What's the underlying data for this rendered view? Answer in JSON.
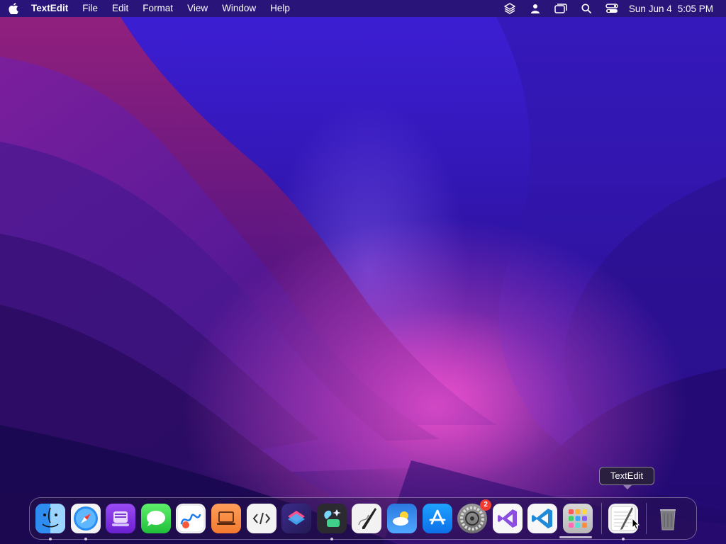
{
  "menubar": {
    "apple_icon": "apple-logo-icon",
    "app_name": "TextEdit",
    "menus": [
      "File",
      "Edit",
      "Format",
      "View",
      "Window",
      "Help"
    ],
    "status_icons": [
      "layers-icon",
      "user-icon",
      "screen-mirroring-icon",
      "search-icon",
      "control-center-icon"
    ],
    "date": "Sun Jun 4",
    "time": "5:05 PM"
  },
  "dock": {
    "items": [
      {
        "name": "Finder",
        "icon": "finder-icon",
        "running": true
      },
      {
        "name": "Safari",
        "icon": "safari-icon",
        "running": true
      },
      {
        "name": "Podcasts",
        "icon": "podcasts-icon",
        "running": false
      },
      {
        "name": "Messages",
        "icon": "messages-icon",
        "running": false
      },
      {
        "name": "Freeform",
        "icon": "freeform-icon",
        "running": false
      },
      {
        "name": "Books",
        "icon": "books-icon",
        "running": false
      },
      {
        "name": "Script Editor",
        "icon": "script-editor-icon",
        "running": false
      },
      {
        "name": "Shortcuts",
        "icon": "shortcuts-icon",
        "running": false
      },
      {
        "name": "Cleaner",
        "icon": "cleaner-icon",
        "running": true
      },
      {
        "name": "Script Editor Pen",
        "icon": "pen-icon",
        "running": false
      },
      {
        "name": "Weather",
        "icon": "weather-icon",
        "running": false
      },
      {
        "name": "App Store",
        "icon": "app-store-icon",
        "running": false
      },
      {
        "name": "System Settings",
        "icon": "settings-icon",
        "running": false,
        "badge": "2"
      },
      {
        "name": "Visual Studio",
        "icon": "visual-studio-icon",
        "running": false
      },
      {
        "name": "Visual Studio Code",
        "icon": "vscode-icon",
        "running": false
      },
      {
        "name": "Launchpad",
        "icon": "launchpad-icon",
        "running": false
      }
    ],
    "recent": [
      {
        "name": "TextEdit",
        "icon": "textedit-icon",
        "running": true
      }
    ],
    "trash": {
      "name": "Trash",
      "icon": "trash-icon"
    }
  },
  "tooltip": {
    "text": "TextEdit"
  },
  "colors": {
    "wallpaper_top": "#3d1fd6",
    "wallpaper_glow": "#ff50c8",
    "badge": "#f23b30"
  }
}
